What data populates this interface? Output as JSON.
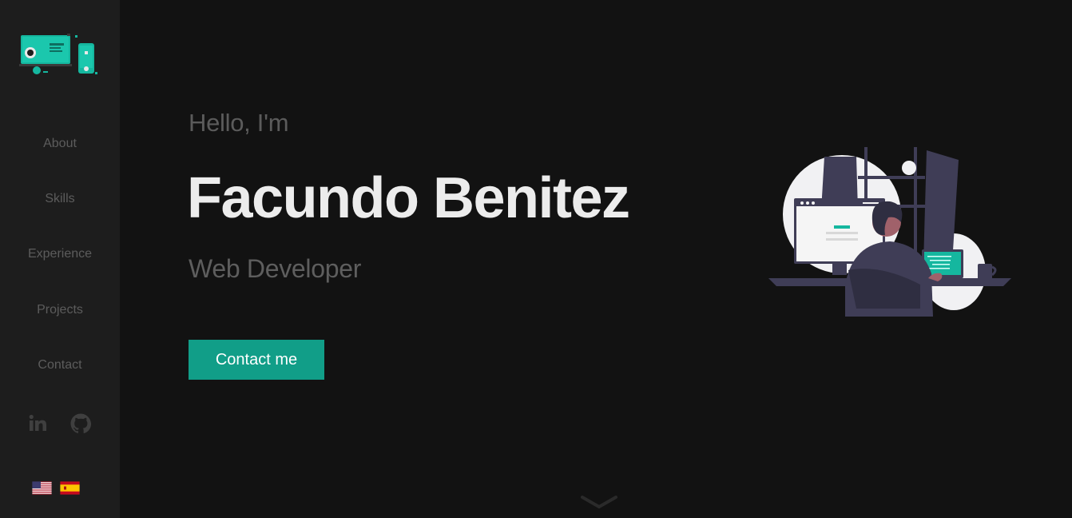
{
  "sidebar": {
    "nav": [
      {
        "label": "About"
      },
      {
        "label": "Skills"
      },
      {
        "label": "Experience"
      },
      {
        "label": "Projects"
      },
      {
        "label": "Contact"
      }
    ],
    "social": [
      {
        "icon": "linkedin-icon"
      },
      {
        "icon": "github-icon"
      }
    ],
    "languages": [
      {
        "icon": "us-flag-icon"
      },
      {
        "icon": "spain-flag-icon"
      }
    ]
  },
  "hero": {
    "greeting": "Hello, I'm",
    "name": "Facundo Benitez",
    "role": "Web Developer",
    "cta_label": "Contact me"
  },
  "colors": {
    "background": "#121212",
    "sidebar": "#1d1d1d",
    "accent": "#119e88",
    "name_text": "#ececec",
    "muted_text": "#5c5c5c"
  }
}
